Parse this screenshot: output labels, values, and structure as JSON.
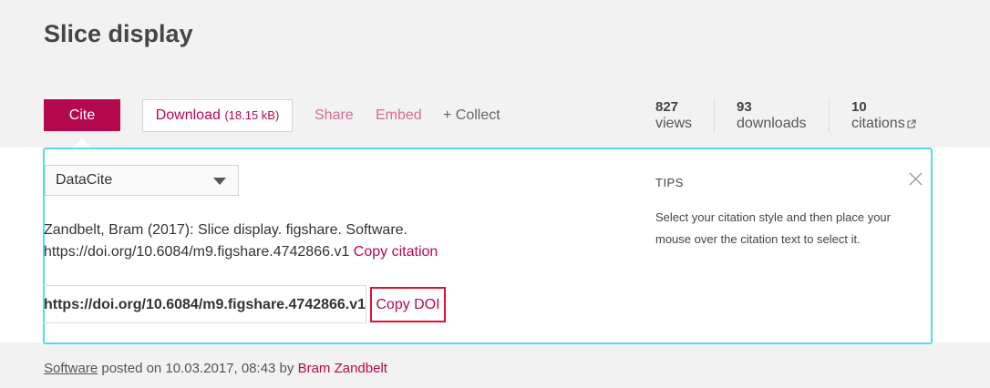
{
  "page": {
    "title": "Slice display"
  },
  "actions": {
    "cite_label": "Cite",
    "download_label": "Download",
    "download_size": "(18.15 kB)",
    "share_label": "Share",
    "embed_label": "Embed",
    "collect_label": "+ Collect"
  },
  "stats": [
    {
      "value": "827",
      "label": "views"
    },
    {
      "value": "93",
      "label": "downloads"
    },
    {
      "value": "10",
      "label": "citations"
    }
  ],
  "cite_panel": {
    "style_selected": "DataCite",
    "citation_line1": "Zandbelt, Bram (2017): Slice display. figshare. Software.",
    "citation_line2": "https://doi.org/10.6084/m9.figshare.4742866.v1",
    "copy_citation_label": "Copy citation",
    "doi_value": "https://doi.org/10.6084/m9.figshare.4742866.v1",
    "copy_doi_label": "Copy DOI",
    "tips_title": "TIPS",
    "tips_text": "Select your citation style and then place your mouse over the citation text to select it."
  },
  "footer": {
    "type": "Software",
    "posted_text": "posted on 10.03.2017, 08:43 by",
    "author": "Bram Zandbelt"
  },
  "colors": {
    "accent": "#b5094f",
    "panel_border": "#5ad8e8",
    "doi_highlight": "#e0112d"
  }
}
